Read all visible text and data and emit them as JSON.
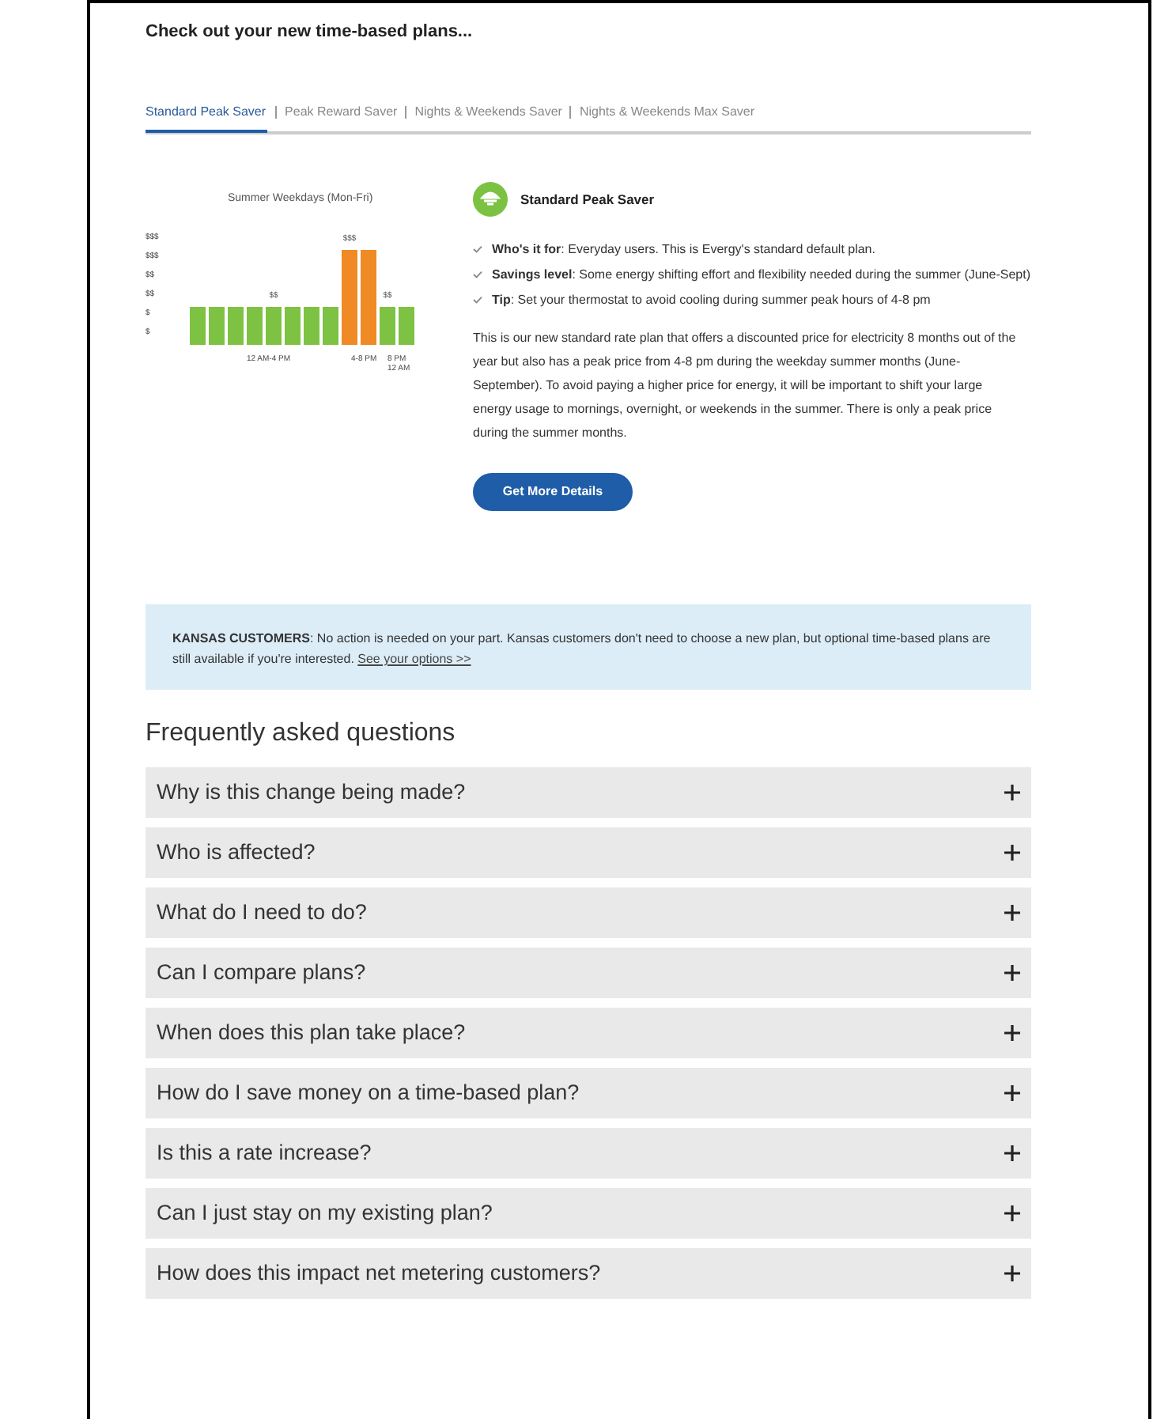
{
  "heading": "Check out your new time-based plans...",
  "tabs": [
    {
      "label": "Standard Peak Saver",
      "selected": true
    },
    {
      "label": "Peak Reward Saver",
      "selected": false
    },
    {
      "label": "Nights & Weekends Saver",
      "selected": false
    },
    {
      "label": "Nights & Weekends Max Saver",
      "selected": false
    }
  ],
  "chart": {
    "title": "Summer Weekdays (Mon-Fri)",
    "y_labels": [
      "$$$",
      "$$$",
      "$$",
      "$$",
      "$",
      "$"
    ],
    "bars": [
      {
        "kind": "off_peak"
      },
      {
        "kind": "off_peak"
      },
      {
        "kind": "off_peak"
      },
      {
        "kind": "off_peak"
      },
      {
        "kind": "off_peak",
        "label": "$$"
      },
      {
        "kind": "off_peak"
      },
      {
        "kind": "off_peak"
      },
      {
        "kind": "off_peak"
      },
      {
        "kind": "peak",
        "label": "$$$"
      },
      {
        "kind": "peak"
      },
      {
        "kind": "off_peak",
        "label": "$$"
      },
      {
        "kind": "off_peak"
      }
    ],
    "x_labels": [
      "12 AM-4 PM",
      "4-8 PM",
      "8 PM 12 AM"
    ]
  },
  "plan": {
    "name": "Standard Peak Saver",
    "points": [
      "**Who's it for**: Everyday users. This is Evergy's standard default plan.",
      "**Savings level**: Some energy shifting effort and flexibility needed during the summer (June-Sept)",
      "**Tip**: Set your thermostat to avoid cooling during summer peak hours of 4-8 pm"
    ],
    "description": "This is our new standard rate plan that offers a discounted price for electricity 8 months out of the year but also has a peak price from 4-8 pm during the weekday summer months (June-September). To avoid paying a higher price for energy, it will be important to shift your large energy usage to mornings, overnight, or weekends in the summer. There is only a peak price during the summer months.",
    "button": "Get More Details"
  },
  "notice": {
    "text": "**KANSAS CUSTOMERS**: No action is needed on your part. Kansas customers don't need to choose a new plan, but optional time-based plans are still available if you're interested.",
    "link": "See your options >>"
  },
  "faq": {
    "title": "Frequently asked questions",
    "items": [
      {
        "question": "Why is this change being made?",
        "expanded": false
      },
      {
        "question": "Who is affected?",
        "expanded": false
      },
      {
        "question": "What do I need to do?",
        "expanded": false
      },
      {
        "question": "Can I compare plans?",
        "expanded": false
      },
      {
        "question": "When does this plan take place?",
        "expanded": false
      },
      {
        "question": "How do I save money on a time-based plan?",
        "expanded": false
      },
      {
        "question": "Is this a rate increase?",
        "expanded": false
      },
      {
        "question": "Can I just stay on my existing plan?",
        "expanded": false
      },
      {
        "question": "How does this impact net metering customers?",
        "expanded": false
      }
    ]
  }
}
